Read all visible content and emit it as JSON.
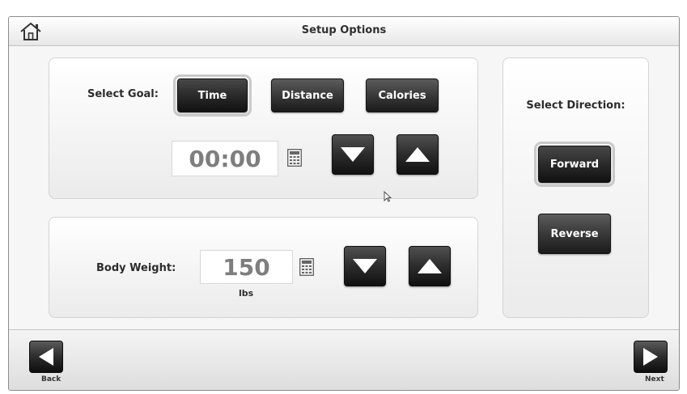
{
  "header": {
    "title": "Setup Options",
    "home_icon": "home-icon"
  },
  "goal": {
    "label": "Select Goal:",
    "options": [
      "Time",
      "Distance",
      "Calories"
    ],
    "selected": "Time",
    "value": "00:00"
  },
  "body_weight": {
    "label": "Body Weight:",
    "value": "150",
    "unit": "lbs"
  },
  "direction": {
    "label": "Select Direction:",
    "options": [
      "Forward",
      "Reverse"
    ],
    "selected": "Forward"
  },
  "footer": {
    "back_label": "Back",
    "next_label": "Next"
  },
  "colors": {
    "button_dark": "#2c2c2c",
    "panel_bg": "#f4f4f4",
    "value_text": "#7e7e7e"
  }
}
